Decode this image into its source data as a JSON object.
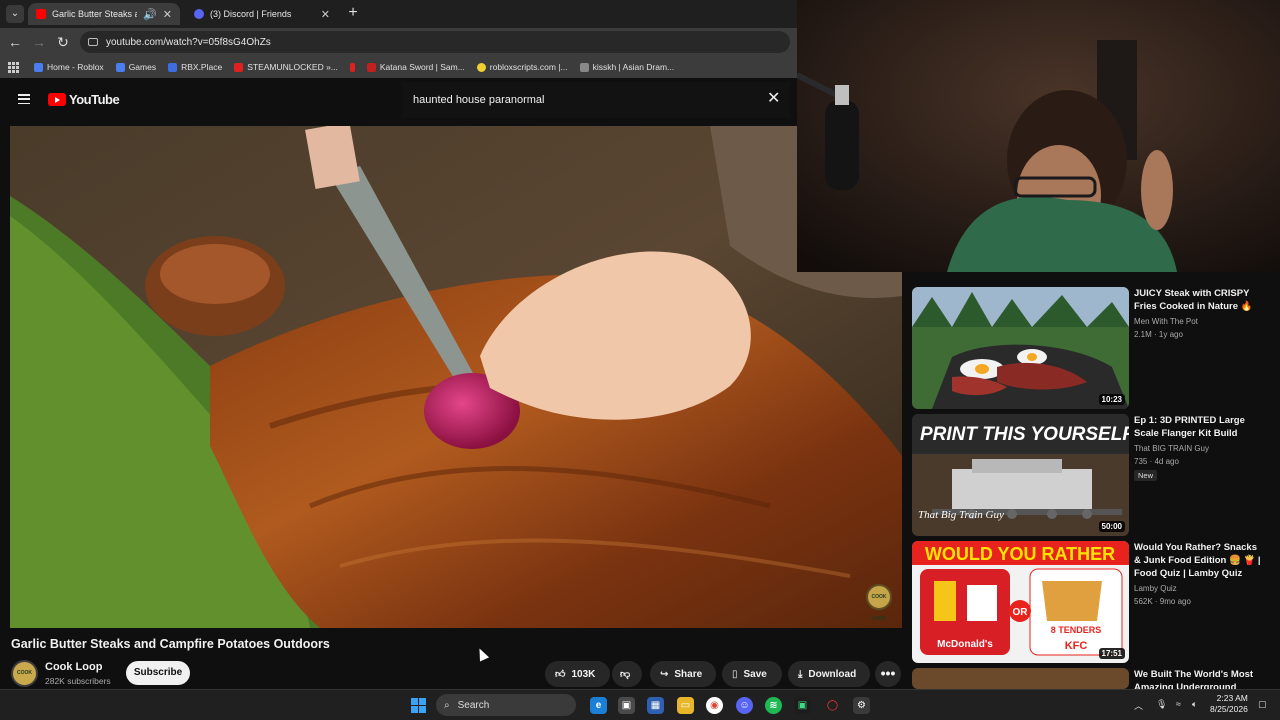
{
  "browser": {
    "tabs": [
      {
        "title": "Garlic Butter Steaks and Ca",
        "active": true,
        "favicon_color": "#ff0000"
      },
      {
        "title": "(3) Discord | Friends",
        "active": false,
        "favicon_color": "#5865f2"
      }
    ],
    "url": "youtube.com/watch?v=05f8sG4OhZs",
    "bookmarks": [
      {
        "label": "Home - Roblox",
        "color": "#4a7df0"
      },
      {
        "label": "Games",
        "color": "#4a7df0"
      },
      {
        "label": "RBX.Place",
        "color": "#3c6ee0"
      },
      {
        "label": "STEAMUNLOCKED »...",
        "color": "#e02020"
      },
      {
        "label": "",
        "color": "#e02020"
      },
      {
        "label": "Katana Sword | Sam...",
        "color": "#c02020"
      },
      {
        "label": "robloxscripts.com |...",
        "color": "#f0d030"
      },
      {
        "label": "kisskh | Asian Dram...",
        "color": "#888888"
      }
    ]
  },
  "youtube": {
    "logo_text": "YouTube",
    "search_query": "haunted house paranormal",
    "video": {
      "title": "Garlic Butter Steaks and Campfire Potatoes Outdoors",
      "watermark": "COOK LOOP",
      "channel_name": "Cook Loop",
      "subscribers": "282K subscribers",
      "subscribe_label": "Subscribe",
      "likes": "103K",
      "share_label": "Share",
      "save_label": "Save",
      "download_label": "Download",
      "more_label": "•••"
    },
    "recommendations": [
      {
        "title": "JUICY Steak with CRISPY Fries Cooked in Nature 🔥",
        "channel": "Men With The Pot",
        "stats": "2.1M · 1y ago",
        "duration": "10:23",
        "new": ""
      },
      {
        "title": "Ep 1: 3D PRINTED Large Scale Flanger Kit Build",
        "channel": "That BIG TRAIN Guy",
        "stats": "735 · 4d ago",
        "duration": "50:00",
        "new": "New",
        "thumb_text": "PRINT THIS YOURSELF",
        "thumb_sub": "That Big Train Guy"
      },
      {
        "title": "Would You Rather? Snacks & Junk Food Edition 🍔 🍟 | Food Quiz | Lamby Quiz",
        "channel": "Lamby Quiz",
        "stats": "562K · 9mo ago",
        "duration": "17:51",
        "new": "",
        "thumb_text": "WOULD YOU RATHER",
        "thumb_left": "McDonald's",
        "thumb_right": "KFC",
        "thumb_or": "OR",
        "thumb_tenders": "8 TENDERS"
      },
      {
        "title": "We Built The World's Most Amazing Underground Water...",
        "channel": "",
        "stats": "",
        "duration": "",
        "new": ""
      }
    ]
  },
  "taskbar": {
    "search_placeholder": "Search",
    "time": "2:23 AM",
    "date": "8/25/2026"
  }
}
